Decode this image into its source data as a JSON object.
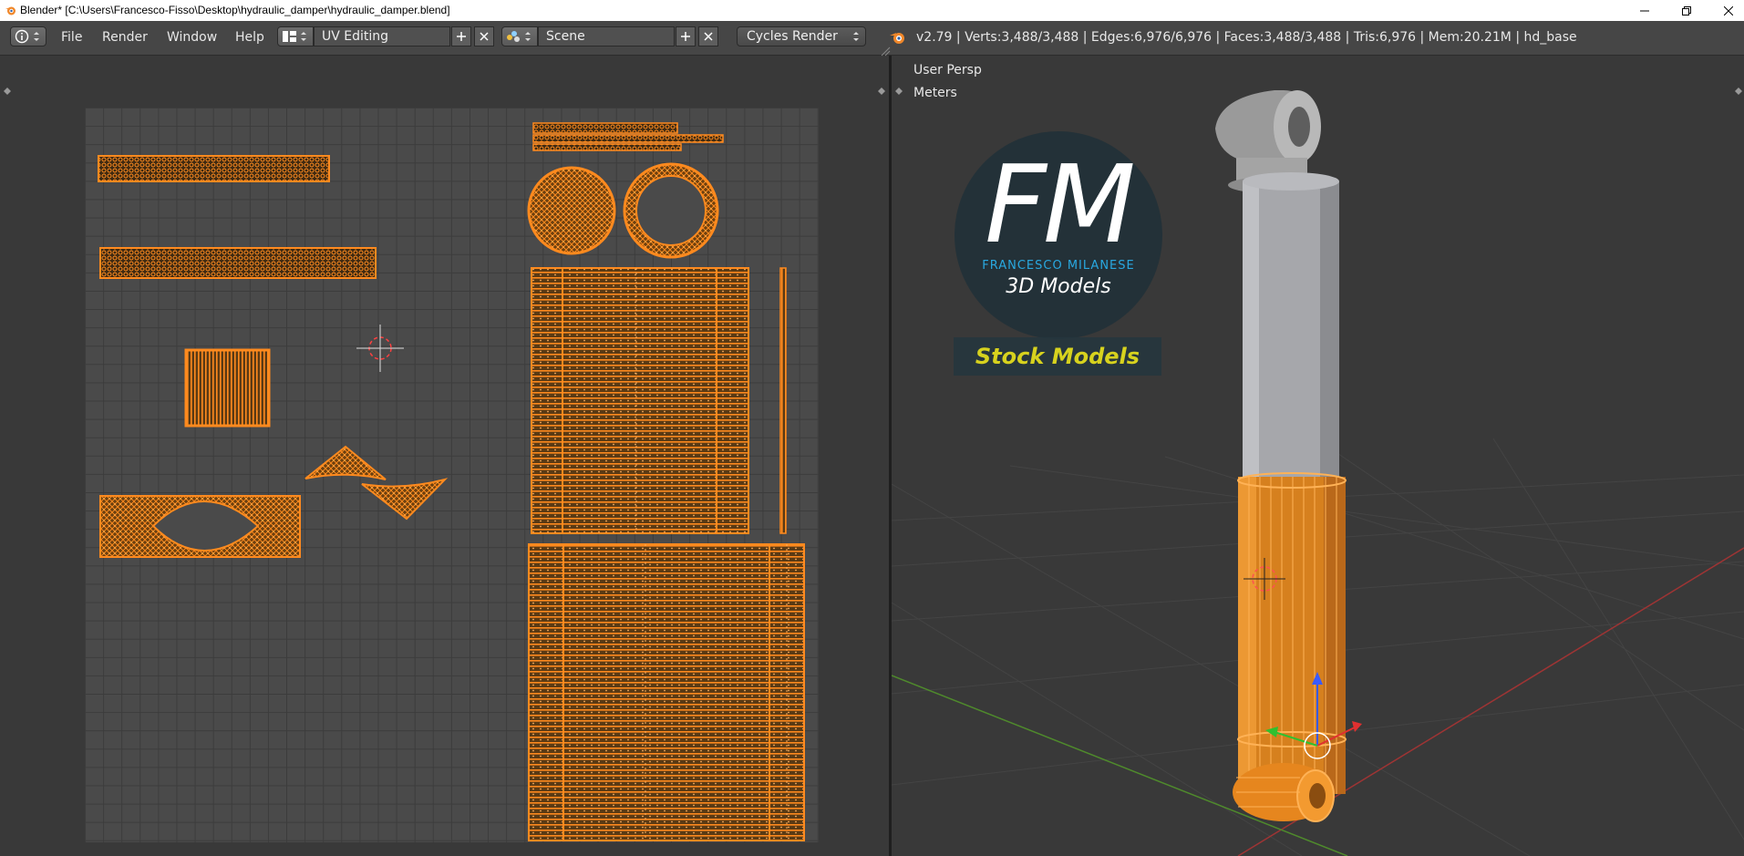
{
  "window": {
    "title": "Blender* [C:\\Users\\Francesco-Fisso\\Desktop\\hydraulic_damper\\hydraulic_damper.blend]"
  },
  "header": {
    "menus": [
      "File",
      "Render",
      "Window",
      "Help"
    ],
    "screen_layout": "UV Editing",
    "scene": "Scene",
    "render_engine": "Cycles Render",
    "stats": "v2.79 | Verts:3,488/3,488 | Edges:6,976/6,976 | Faces:3,488/3,488 | Tris:6,976 | Mem:20.21M | hd_base"
  },
  "viewport": {
    "view_label": "User Persp",
    "units_label": "Meters"
  },
  "watermark": {
    "logo_letters": "FM",
    "brand_name": "FRANCESCO MILANESE",
    "subtitle": "3D Models",
    "tag": "Stock Models"
  },
  "colors": {
    "ui_background": "#393939",
    "header": "#464646",
    "uv_grid": "#4a4a4a",
    "selection_orange": "#ff8a1e",
    "brand_blue": "#29a8e0",
    "stock_yellow": "#d7d21e"
  }
}
